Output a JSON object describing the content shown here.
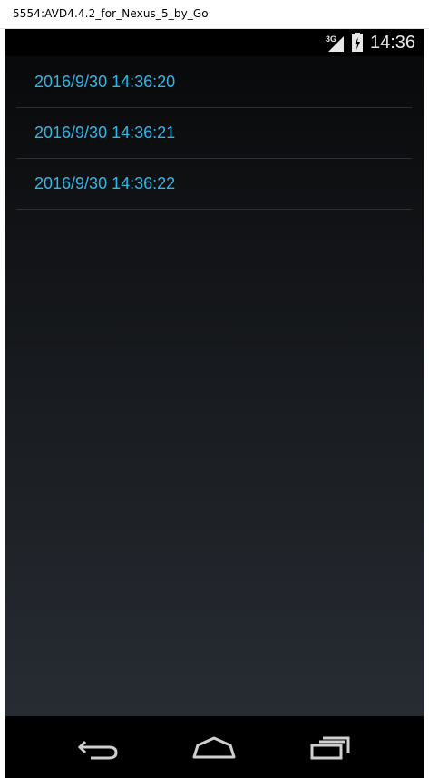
{
  "window": {
    "title": "5554:AVD4.4.2_for_Nexus_5_by_Go"
  },
  "status_bar": {
    "network_type": "3G",
    "time": "14:36",
    "icons": [
      "signal-3g-icon",
      "battery-charging-icon"
    ]
  },
  "list": {
    "items": [
      {
        "label": "2016/9/30 14:36:20"
      },
      {
        "label": "2016/9/30 14:36:21"
      },
      {
        "label": "2016/9/30 14:36:22"
      }
    ]
  },
  "nav_bar": {
    "icons": [
      "back-icon",
      "home-icon",
      "recent-apps-icon"
    ]
  },
  "colors": {
    "accent": "#33b5e5",
    "status_bar_bg": "#000000",
    "nav_bar_bg": "#000000"
  }
}
